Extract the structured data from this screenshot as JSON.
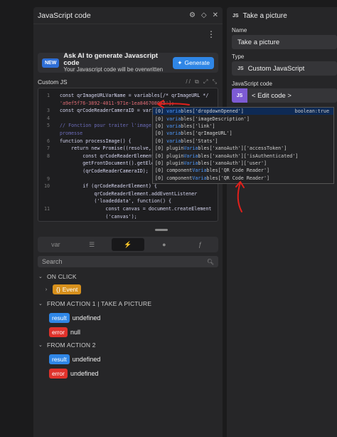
{
  "left_panel": {
    "title": "JavaScript code",
    "header_icons": [
      "gear-icon",
      "expand-icon",
      "close-icon"
    ],
    "ai_banner": {
      "badge": "NEW",
      "title": "Ask AI to generate Javascript code",
      "subtitle": "Your Javascript code will be overwritten",
      "button_label": "Generate"
    },
    "editor_label": "Custom JS",
    "editor_tools": "// ⧉ ⤢ ⤡",
    "code_lines": [
      {
        "n": "1",
        "text": "const qrImageURLVarName = variables[/* qrImageURL */"
      },
      {
        "n": "",
        "text": "'a9ef5f76-3892-4011-971e-1ea846708055'];"
      },
      {
        "n": "3",
        "text": "const qrCodeReaderCameraID = varia;"
      },
      {
        "n": "4",
        "text": ""
      },
      {
        "n": "5",
        "text": "// Fonction pour traiter l'image d"
      },
      {
        "n": "",
        "text": "promesse"
      },
      {
        "n": "6",
        "text": "function processImage() {"
      },
      {
        "n": "7",
        "text": "    return new Promise((resolve, r"
      },
      {
        "n": "8",
        "text": "        const qrCodeReaderElement"
      },
      {
        "n": "",
        "text": "        getFrontDocument().getElem"
      },
      {
        "n": "",
        "text": "        (qrCodeReaderCameraID);"
      },
      {
        "n": "9",
        "text": ""
      },
      {
        "n": "10",
        "text": "        if (qrCodeReaderElement) {"
      },
      {
        "n": "",
        "text": "            qrCodeReaderElement.addEventListener"
      },
      {
        "n": "",
        "text": "            ('loadeddata', function() {"
      },
      {
        "n": "11",
        "text": "                const canvas = document.createElement"
      },
      {
        "n": "",
        "text": "                ('canvas');"
      }
    ],
    "autocomplete": [
      {
        "type": "[0]",
        "pre": "",
        "hl": "varia",
        "post": "bles['dropdownOpened']",
        "detail": "boolean:true"
      },
      {
        "type": "[0]",
        "pre": "",
        "hl": "varia",
        "post": "bles['imageDescription']",
        "detail": ""
      },
      {
        "type": "[0]",
        "pre": "",
        "hl": "varia",
        "post": "bles['link']",
        "detail": ""
      },
      {
        "type": "[0]",
        "pre": "",
        "hl": "varia",
        "post": "bles['qrImageURL']",
        "detail": ""
      },
      {
        "type": "[0]",
        "pre": "",
        "hl": "varia",
        "post": "bles['Stats']",
        "detail": ""
      },
      {
        "type": "[0]",
        "pre": "plugin",
        "hl": "Varia",
        "post": "bles['xanoAuth']['accessToken']",
        "detail": ""
      },
      {
        "type": "[0]",
        "pre": "plugin",
        "hl": "Varia",
        "post": "bles['xanoAuth']['isAuthenticated']",
        "detail": ""
      },
      {
        "type": "[0]",
        "pre": "plugin",
        "hl": "Varia",
        "post": "bles['xanoAuth']['user']",
        "detail": ""
      },
      {
        "type": "[0]",
        "pre": "component",
        "hl": "Varia",
        "post": "bles['QR Code Reader']",
        "detail": ""
      },
      {
        "type": "[0]",
        "pre": "component",
        "hl": "Varia",
        "post": "bles['QR Code Reader']",
        "detail": ""
      }
    ],
    "tabs": [
      {
        "name": "tab-variables",
        "label": "var"
      },
      {
        "name": "tab-data",
        "label": "☰"
      },
      {
        "name": "tab-actions",
        "label": "⚡"
      },
      {
        "name": "tab-user",
        "label": "●"
      },
      {
        "name": "tab-formulas",
        "label": "ƒ"
      }
    ],
    "search_placeholder": "Search",
    "tree": {
      "on_click": "ON CLICK",
      "event_label": "Event",
      "action1": "FROM ACTION 1 | TAKE A PICTURE",
      "action1_result_badge": "result",
      "action1_result_value": "undefined",
      "action1_error_badge": "error",
      "action1_error_value": "null",
      "action2": "FROM ACTION 2",
      "action2_result_badge": "result",
      "action2_result_value": "undefined",
      "action2_error_badge": "error",
      "action2_error_value": "undefined"
    }
  },
  "right_panel": {
    "title": "Take a picture",
    "name_label": "Name",
    "name_value": "Take a picture",
    "type_label": "Type",
    "type_value": "Custom JavaScript",
    "js_label": "JavaScript code",
    "edit_button": "< Edit code >",
    "js_badge": "JS"
  },
  "colors": {
    "accent_blue": "#2f86e6",
    "error_red": "#e0322b",
    "event_orange": "#d7901c",
    "js_purple": "#7d5bd4",
    "annotation_red": "#e0201c"
  }
}
